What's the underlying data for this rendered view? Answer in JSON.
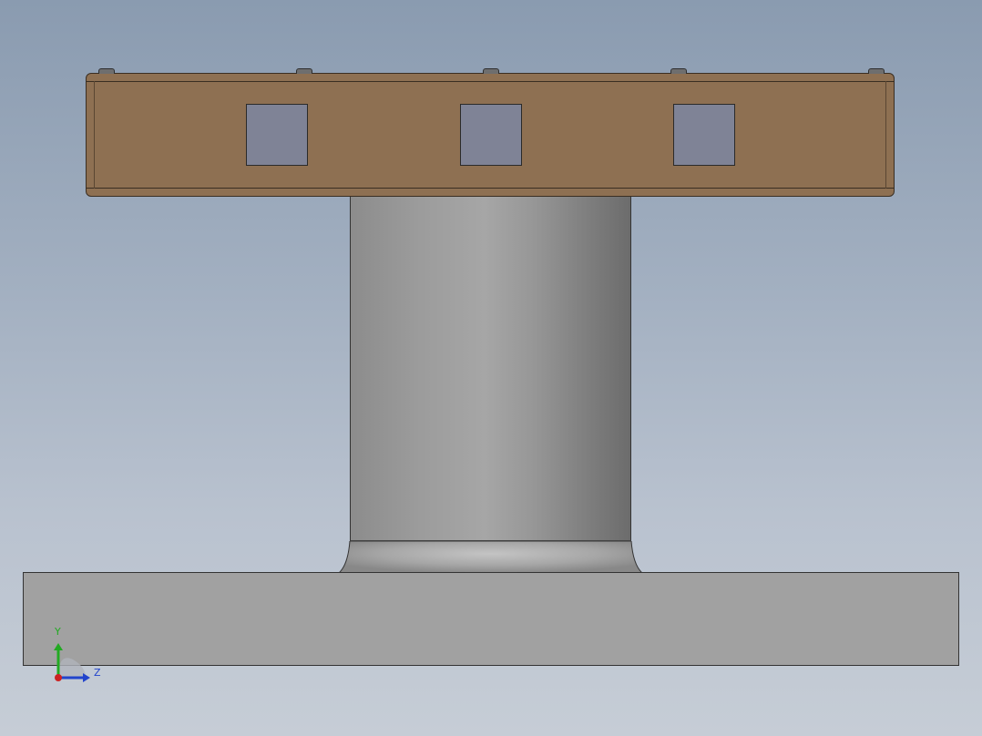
{
  "viewport": {
    "background_top_color": "#8a9bb0",
    "background_bottom_color": "#c6cdd6"
  },
  "model": {
    "beam_color": "#8e7052",
    "hole_color": "#7f8396",
    "column_color": "#9c9c9c",
    "base_color": "#a1a1a1",
    "square_holes_count": 3,
    "bolts_count": 5
  },
  "triad": {
    "y_label": "Y",
    "z_label": "Z",
    "y_color": "#22aa22",
    "z_color": "#2244cc",
    "x_color": "#cc2222"
  }
}
